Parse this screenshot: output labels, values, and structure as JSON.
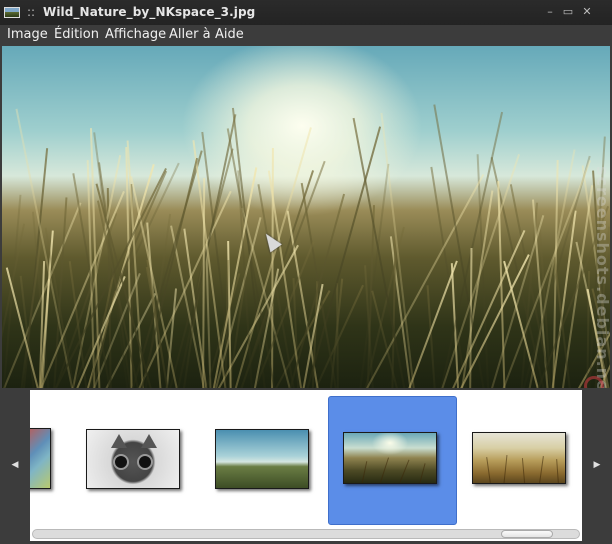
{
  "window": {
    "title": "Wild_Nature_by_NKspace_3.jpg",
    "separator": "::",
    "controls": {
      "minimize": "–",
      "restore": "▭",
      "close": "✕"
    }
  },
  "menu": [
    "Image",
    "Édition",
    "Affichage",
    "Aller à",
    "Aide"
  ],
  "viewer": {
    "watermark": "screenshots.debian.net"
  },
  "thumbnails": {
    "prev_arrow": "◀",
    "next_arrow": "▶",
    "items": [
      {
        "id": "colorful-partial"
      },
      {
        "id": "cat-sunglasses"
      },
      {
        "id": "green-field-sky"
      },
      {
        "id": "wild-nature-grass",
        "selected": true
      },
      {
        "id": "golden-wheat-field"
      }
    ]
  },
  "colors": {
    "selection": "#5b8de8",
    "chrome": "#3c3c3c",
    "titlebar": "#2b2b2b"
  }
}
